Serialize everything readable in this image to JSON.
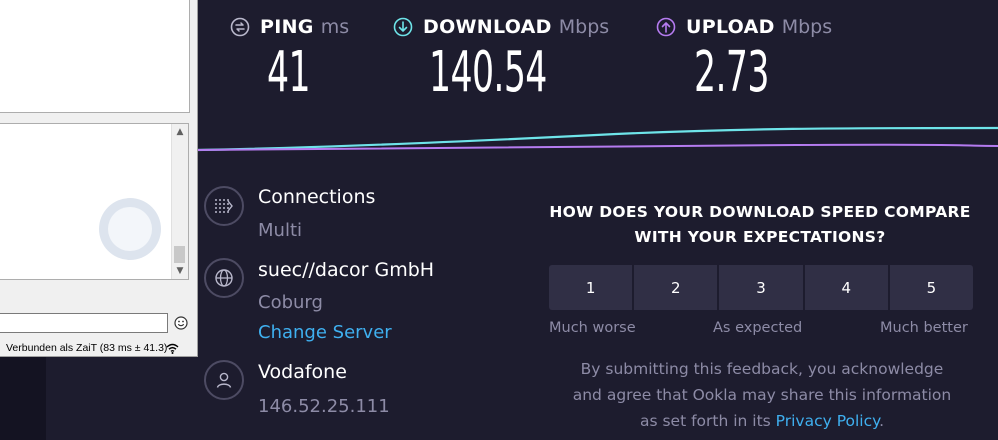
{
  "results": {
    "ping": {
      "label": "PING",
      "unit": "ms",
      "value": "41",
      "icon": "ping-icon"
    },
    "download": {
      "label": "DOWNLOAD",
      "unit": "Mbps",
      "value": "140.54",
      "icon": "download-arrow-icon"
    },
    "upload": {
      "label": "UPLOAD",
      "unit": "Mbps",
      "value": "2.73",
      "icon": "upload-arrow-icon"
    }
  },
  "server": {
    "connections_label": "Connections",
    "connections_value": "Multi",
    "host": "suec//dacor GmbH",
    "location": "Coburg",
    "change_server": "Change Server",
    "isp": "Vodafone",
    "ip": "146.52.25.111"
  },
  "feedback": {
    "question_line1": "HOW DOES YOUR DOWNLOAD SPEED COMPARE",
    "question_line2": "WITH YOUR EXPECTATIONS?",
    "ratings": [
      "1",
      "2",
      "3",
      "4",
      "5"
    ],
    "label_low": "Much worse",
    "label_mid": "As expected",
    "label_high": "Much better",
    "disclaimer_line1": "By submitting this feedback, you acknowledge",
    "disclaimer_line2": "and agree that Ookla may share this information",
    "disclaimer_line3_prefix": "as set forth in its",
    "privacy_link": "Privacy Policy",
    "disclaimer_suffix": "."
  },
  "chat_window": {
    "status": "Verbunden als ZaiT (83 ms ± 41.3)"
  },
  "colors": {
    "background": "#1d1c2e",
    "download_accent": "#6ee4e9",
    "upload_accent": "#b57bf0",
    "link": "#3fb0f0"
  }
}
